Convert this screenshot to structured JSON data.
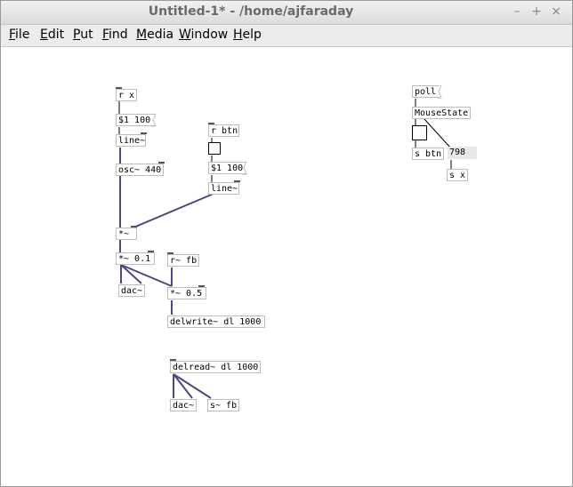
{
  "window": {
    "title": "Untitled-1* - /home/ajfaraday",
    "minimize_label": "–",
    "maximize_label": "+",
    "close_label": "×"
  },
  "menu": {
    "items": [
      {
        "label": "File",
        "mnemonic": "F",
        "rest": "ile"
      },
      {
        "label": "Edit",
        "mnemonic": "E",
        "rest": "dit"
      },
      {
        "label": "Put",
        "mnemonic": "P",
        "rest": "ut"
      },
      {
        "label": "Find",
        "mnemonic": "F",
        "rest": "ind"
      },
      {
        "label": "Media",
        "mnemonic": "M",
        "rest": "edia"
      },
      {
        "label": "Window",
        "mnemonic": "W",
        "rest": "indow"
      },
      {
        "label": "Help",
        "mnemonic": "H",
        "rest": "elp"
      }
    ]
  },
  "patch": {
    "objects": {
      "r_x": "r x",
      "msg_1": "$1 100",
      "line_1": "line~",
      "osc": "osc~ 440",
      "r_btn": "r btn",
      "msg_2": "$1 100",
      "line_2": "line~",
      "mul": "*~",
      "mul_01": "*~ 0.1",
      "r_fb": "r~ fb",
      "dac_1": "dac~",
      "mul_05": "*~ 0.5",
      "delwrite": "delwrite~ dl 1000",
      "delread": "delread~ dl 1000",
      "dac_2": "dac~",
      "s_fb": "s~ fb",
      "poll": "poll",
      "mousestate": "MouseState",
      "s_btn": "s btn",
      "number": "798",
      "s_x": "s x"
    }
  },
  "colors": {
    "cord_audio": "#4a4a80",
    "cord_control": "#000000",
    "object_border": "#bdbdbd",
    "port": "#555555"
  }
}
